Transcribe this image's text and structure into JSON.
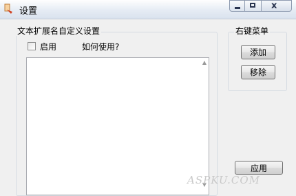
{
  "window": {
    "title": "设置"
  },
  "titlebar": {
    "close_glyph": "x"
  },
  "left_group": {
    "legend": "文本扩展名自定义设置",
    "enable_label": "启用",
    "enable_checked": false,
    "howto_label": "如何使用?"
  },
  "right_group": {
    "legend": "右键菜单",
    "add_label": "添加",
    "remove_label": "移除"
  },
  "apply_label": "应用",
  "watermark": "ASPKU.COM",
  "icons": {
    "app": "window-settings-icon",
    "minimize": "minimize-icon",
    "maximize": "maximize-icon",
    "close": "close-icon"
  }
}
